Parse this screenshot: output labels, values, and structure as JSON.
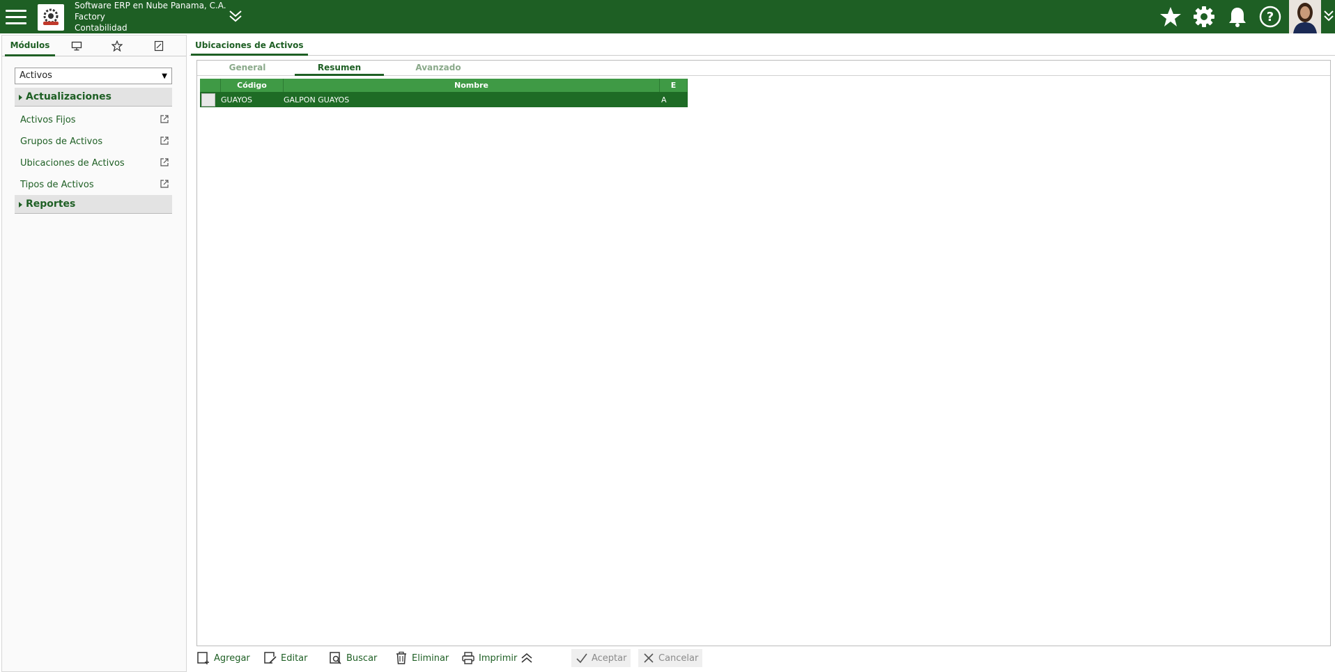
{
  "header": {
    "company_line1": "Software ERP en Nube Panama, C.A.",
    "company_line2": "Factory",
    "company_line3": "Contabilidad"
  },
  "sidebar": {
    "tabs": [
      {
        "label": "Módulos",
        "icon": "modules"
      },
      {
        "label": "",
        "icon": "monitor-icon"
      },
      {
        "label": "",
        "icon": "star-icon"
      },
      {
        "label": "",
        "icon": "document-icon"
      }
    ],
    "module_select": "Activos",
    "sections": [
      {
        "label": "Actualizaciones"
      },
      {
        "label": "Reportes"
      }
    ],
    "items": [
      {
        "label": "Activos Fijos"
      },
      {
        "label": "Grupos de Activos"
      },
      {
        "label": "Ubicaciones de Activos"
      },
      {
        "label": "Tipos de Activos"
      }
    ]
  },
  "main": {
    "tab_label": "Ubicaciones de Activos",
    "sub_tabs": [
      {
        "label": "General"
      },
      {
        "label": "Resumen"
      },
      {
        "label": "Avanzado"
      }
    ],
    "grid": {
      "headers": [
        "Código",
        "Nombre",
        "E"
      ],
      "rows": [
        {
          "codigo": "GUAYOS",
          "nombre": "GALPON GUAYOS",
          "estado": "A"
        }
      ]
    }
  },
  "toolbar": {
    "agregar": "Agregar",
    "editar": "Editar",
    "buscar": "Buscar",
    "eliminar": "Eliminar",
    "imprimir": "Imprimir",
    "aceptar": "Aceptar",
    "cancelar": "Cancelar"
  },
  "colors": {
    "brand": "#1e5f24",
    "grid_header": "#3f9a45",
    "grid_row_selected": "#1e6b25"
  }
}
